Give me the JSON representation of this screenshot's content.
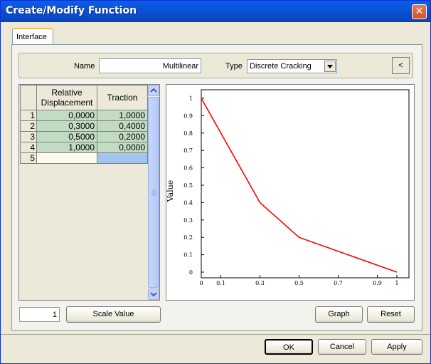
{
  "window": {
    "title": "Create/Modify Function",
    "close_glyph": "✕"
  },
  "tabs": [
    {
      "label": "Interface"
    }
  ],
  "form": {
    "name_label": "Name",
    "name_value": "Multilinear",
    "type_label": "Type",
    "type_value": "Discrete Cracking",
    "collapse_label": "<"
  },
  "table": {
    "headers": [
      "Relative Displacement",
      "Traction"
    ],
    "rows": [
      {
        "num": "1",
        "disp": "0,0000",
        "traction": "1,0000"
      },
      {
        "num": "2",
        "disp": "0,3000",
        "traction": "0,4000"
      },
      {
        "num": "3",
        "disp": "0,5000",
        "traction": "0,2000"
      },
      {
        "num": "4",
        "disp": "1,0000",
        "traction": "0,0000"
      },
      {
        "num": "5",
        "disp": "",
        "traction": ""
      }
    ]
  },
  "scale": {
    "value": "1",
    "button_label": "Scale Value"
  },
  "graph_buttons": {
    "graph_label": "Graph",
    "reset_label": "Reset"
  },
  "dialog_buttons": {
    "ok": "OK",
    "cancel": "Cancel",
    "apply": "Apply"
  },
  "colors": {
    "line": "#ff0000",
    "filled_cell": "#c2dcc2",
    "empty_cell": "#fdfbee",
    "selected_cell": "#a4c4f0"
  },
  "chart_data": {
    "type": "line",
    "ylabel": "Value",
    "xlim": [
      0,
      1
    ],
    "ylim": [
      0,
      1
    ],
    "x_ticks": [
      "0",
      "0.1",
      "0.3",
      "0.5",
      "0.7",
      "0.9",
      "1"
    ],
    "x_tick_values": [
      0,
      0.1,
      0.3,
      0.5,
      0.7,
      0.9,
      1
    ],
    "y_ticks": [
      "0",
      "0.1",
      "0.2",
      "0.3",
      "0.4",
      "0.5",
      "0.6",
      "0.7",
      "0.8",
      "0.9",
      "1"
    ],
    "y_tick_values": [
      0,
      0.1,
      0.2,
      0.3,
      0.4,
      0.5,
      0.6,
      0.7,
      0.8,
      0.9,
      1
    ],
    "series": [
      {
        "x": [
          0,
          0.3,
          0.5,
          1
        ],
        "y": [
          1,
          0.4,
          0.2,
          0
        ]
      }
    ]
  }
}
